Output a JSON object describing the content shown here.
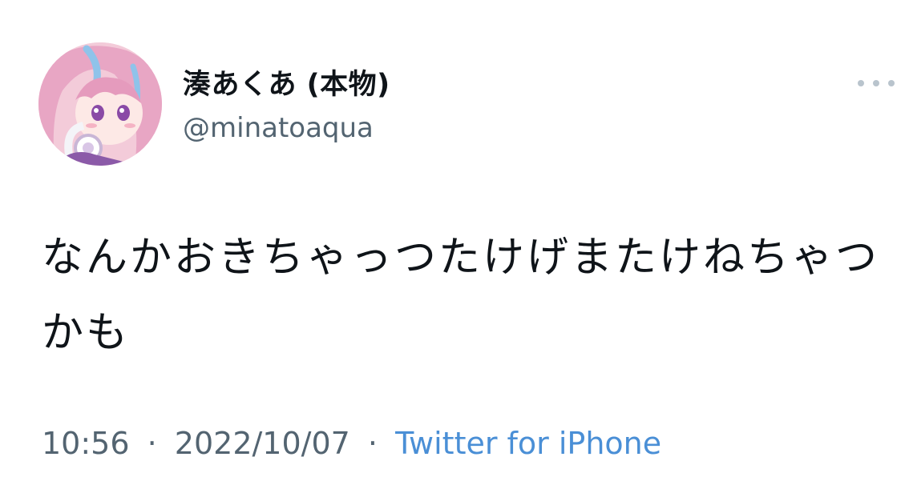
{
  "author": {
    "display_name": "湊あくあ (本物)",
    "handle": "@minatoaqua",
    "avatar_icon": "profile-avatar"
  },
  "menu": {
    "more_icon": "more-horizontal-icon"
  },
  "tweet": {
    "text": "なんかおきちゃっつたけげまたけねちゃつかも"
  },
  "meta": {
    "time": "10:56",
    "separator": "·",
    "date": "2022/10/07",
    "source": "Twitter for iPhone"
  },
  "colors": {
    "text": "#0f1419",
    "secondary": "#536471",
    "link": "#4a8fd6",
    "background": "#ffffff"
  }
}
